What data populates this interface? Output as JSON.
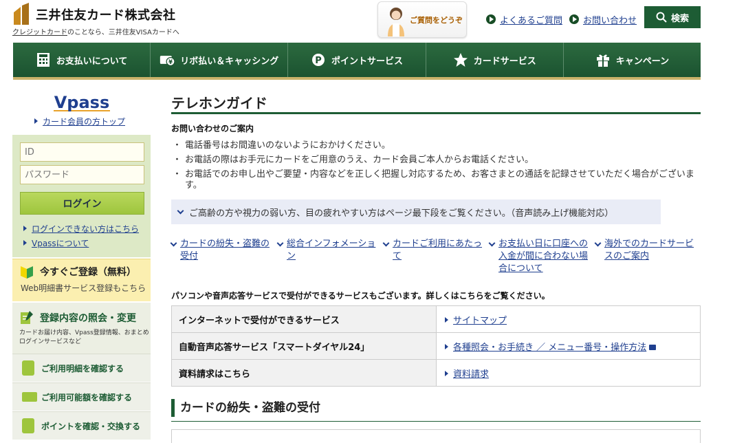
{
  "header": {
    "company_name": "三井住友カード株式会社",
    "tagline_link": "クレジットカード",
    "tagline_rest": "のことなら、三井住友VISAカードへ",
    "qa_banner_text": "ご質問をどうぞ",
    "faq_link": "よくあるご質問",
    "contact_link": "お問い合わせ",
    "search_button": "検索"
  },
  "nav": {
    "items": [
      {
        "label": "お支払いについて",
        "icon": "calculator-icon"
      },
      {
        "label": "リボ払い＆キャッシング",
        "icon": "wallet-yen-icon"
      },
      {
        "label": "ポイントサービス",
        "icon": "point-icon"
      },
      {
        "label": "カードサービス",
        "icon": "star-icon"
      },
      {
        "label": "キャンペーン",
        "icon": "gift-icon"
      }
    ]
  },
  "sidebar": {
    "vpass_logo": "Vpass",
    "vpass_top_link": "カード会員の方トップ",
    "id_placeholder": "ID",
    "password_placeholder": "パスワード",
    "login_button": "ログイン",
    "cannot_login_link": "ログインできない方はこちら",
    "about_vpass_link": "Vpassについて",
    "register_title": "今すぐご登録（無料）",
    "register_sub": "Web明細書サービス登録もこちら",
    "change_title": "登録内容の照会・変更",
    "change_sub": "カードお届け内容、Vpass登録情報、おまとめログインサービスなど",
    "rows": [
      {
        "label": "ご利用明細を確認する"
      },
      {
        "label": "ご利用可能額を確認する"
      },
      {
        "label": "ポイントを確認・交換する"
      }
    ]
  },
  "main": {
    "title": "テレホンガイド",
    "section_heading": "お問い合わせのご案内",
    "bullets": [
      "電話番号はお間違いのないようにおかけください。",
      "お電話の際はお手元にカードをご用意のうえ、カード会員ご本人からお電話ください。",
      "お電話でのお申し出やご要望・内容などを正しく把握し対応するため、お客さまとの通話を記録させていただく場合がございます。"
    ],
    "notice": "ご高齢の方や視力の弱い方、目の疲れやすい方はページ最下段をご覧ください。（音声読み上げ機能対応）",
    "anchor_links": [
      "カードの紛失・盗難の受付",
      "総合インフォメーション",
      "カードご利用にあたって",
      "お支払い日に口座への入金が間に合わない場合について",
      "海外でのカードサービスのご案内"
    ],
    "service_note": "パソコンや音声応答サービスで受付ができるサービスもございます。詳しくはこちらをご覧ください。",
    "table": [
      {
        "label": "インターネットで受付ができるサービス",
        "link": "サイトマップ"
      },
      {
        "label": "自動音声応答サービス「スマートダイヤル24」",
        "link": "各種照会・お手続き ／ メニュー番号・操作方法"
      },
      {
        "label": "資料請求はこちら",
        "link": "資料請求"
      }
    ],
    "loss_heading": "カードの紛失・盗難の受付"
  }
}
